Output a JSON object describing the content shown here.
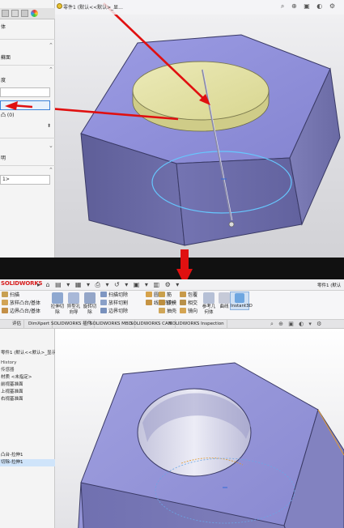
{
  "top": {
    "breadcrumb": "零件1 (默认<<默认>_显...",
    "sidebar": {
      "rows": [
        "体",
        "蘇面",
        "度",
        "凸 (0)",
        "明"
      ],
      "field_text": "1>"
    },
    "colors": {
      "face_top": "#e6e3a0",
      "hex_top": "#8c8cd8",
      "hex_side_dark": "#6a6aa6",
      "arrow": "#e01010"
    }
  },
  "bottom": {
    "logo": "SOLIDWORKS",
    "ribbon": {
      "left_col": [
        "扫描",
        "放样凸台/基体",
        "边界凸台/基体"
      ],
      "big_buttons": [
        "拉伸切除",
        "异型孔向导",
        "旋转切除"
      ],
      "mid_col": [
        "扫描切除",
        "放样切割",
        "边界切除"
      ],
      "right_col1": [
        "圆角",
        "线性阵列"
      ],
      "right_col2": [
        "筋",
        "拔模",
        "抽壳"
      ],
      "right_col3": [
        "包覆",
        "相交",
        "镜向"
      ],
      "right_big": [
        "参考几何体",
        "曲线"
      ],
      "instant3d": "Instant3D"
    },
    "tabs": [
      "评估",
      "DimXpert",
      "SOLIDWORKS 插件",
      "SOLIDWORKS MBD",
      "SOLIDWORKS CAM",
      "SOLIDWORKS Inspection"
    ],
    "tree": {
      "header": "零件1 (默认<<默认>_显示状态 1>)",
      "items": [
        "History",
        "传感器",
        "注解",
        "材质 <未指定>",
        "前视基准面",
        "上视基准面",
        "右视基准面",
        "原点",
        "凸台-拉伸1",
        "切除-拉伸1"
      ]
    },
    "colors": {
      "hex_top": "#9898d8",
      "hex_side": "#7a7ab4",
      "hole": "#f0f0f6",
      "edge": "#e09a30"
    }
  }
}
